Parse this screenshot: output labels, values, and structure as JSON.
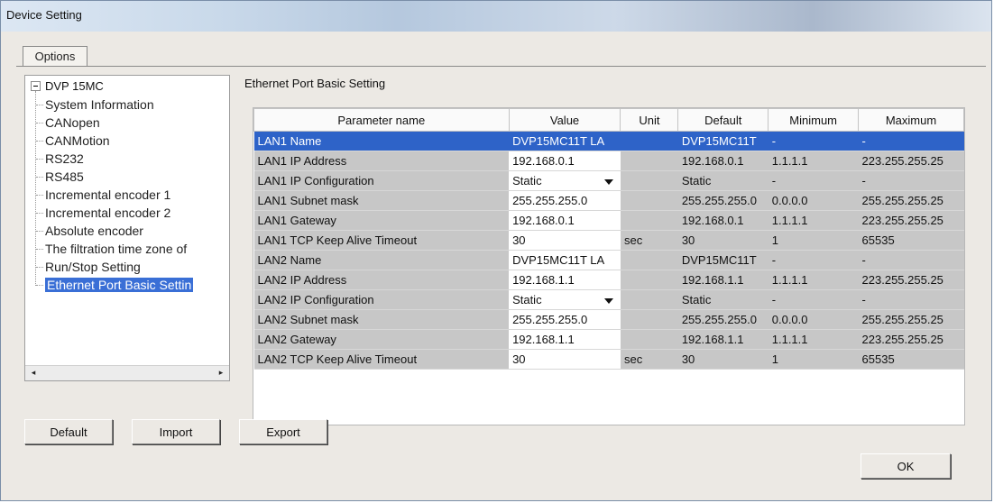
{
  "window": {
    "title": "Device Setting"
  },
  "tab": {
    "label": "Options"
  },
  "tree": {
    "root": "DVP 15MC",
    "items": [
      {
        "label": "System Information",
        "selected": false
      },
      {
        "label": "CANopen",
        "selected": false
      },
      {
        "label": "CANMotion",
        "selected": false
      },
      {
        "label": "RS232",
        "selected": false
      },
      {
        "label": "RS485",
        "selected": false
      },
      {
        "label": "Incremental encoder 1",
        "selected": false
      },
      {
        "label": "Incremental encoder 2",
        "selected": false
      },
      {
        "label": "Absolute encoder",
        "selected": false
      },
      {
        "label": "The filtration time zone of",
        "selected": false
      },
      {
        "label": "Run/Stop Setting",
        "selected": false
      },
      {
        "label": "Ethernet Port Basic Settin",
        "selected": true
      }
    ],
    "scroll_left_icon": "◂",
    "scroll_right_icon": "▸"
  },
  "section_title": "Ethernet Port Basic Setting",
  "table": {
    "columns": [
      "Parameter name",
      "Value",
      "Unit",
      "Default",
      "Minimum",
      "Maximum"
    ],
    "rows": [
      {
        "name": "LAN1 Name",
        "value": "DVP15MC11T LA",
        "unit": "",
        "default": "DVP15MC11T",
        "min": "-",
        "max": "-",
        "dropdown": false,
        "selected": true
      },
      {
        "name": "LAN1 IP Address",
        "value": "192.168.0.1",
        "unit": "",
        "default": "192.168.0.1",
        "min": "1.1.1.1",
        "max": "223.255.255.25",
        "dropdown": false,
        "selected": false
      },
      {
        "name": "LAN1 IP Configuration",
        "value": "Static",
        "unit": "",
        "default": "Static",
        "min": "-",
        "max": "-",
        "dropdown": true,
        "selected": false
      },
      {
        "name": "LAN1 Subnet mask",
        "value": "255.255.255.0",
        "unit": "",
        "default": "255.255.255.0",
        "min": "0.0.0.0",
        "max": "255.255.255.25",
        "dropdown": false,
        "selected": false
      },
      {
        "name": "LAN1 Gateway",
        "value": "192.168.0.1",
        "unit": "",
        "default": "192.168.0.1",
        "min": "1.1.1.1",
        "max": "223.255.255.25",
        "dropdown": false,
        "selected": false
      },
      {
        "name": "LAN1 TCP Keep Alive Timeout",
        "value": "30",
        "unit": "sec",
        "default": "30",
        "min": "1",
        "max": "65535",
        "dropdown": false,
        "selected": false
      },
      {
        "name": "LAN2 Name",
        "value": "DVP15MC11T LA",
        "unit": "",
        "default": "DVP15MC11T",
        "min": "-",
        "max": "-",
        "dropdown": false,
        "selected": false
      },
      {
        "name": "LAN2 IP Address",
        "value": "192.168.1.1",
        "unit": "",
        "default": "192.168.1.1",
        "min": "1.1.1.1",
        "max": "223.255.255.25",
        "dropdown": false,
        "selected": false
      },
      {
        "name": "LAN2 IP Configuration",
        "value": "Static",
        "unit": "",
        "default": "Static",
        "min": "-",
        "max": "-",
        "dropdown": true,
        "selected": false
      },
      {
        "name": "LAN2 Subnet mask",
        "value": "255.255.255.0",
        "unit": "",
        "default": "255.255.255.0",
        "min": "0.0.0.0",
        "max": "255.255.255.25",
        "dropdown": false,
        "selected": false
      },
      {
        "name": "LAN2 Gateway",
        "value": "192.168.1.1",
        "unit": "",
        "default": "192.168.1.1",
        "min": "1.1.1.1",
        "max": "223.255.255.25",
        "dropdown": false,
        "selected": false
      },
      {
        "name": "LAN2 TCP Keep Alive Timeout",
        "value": "30",
        "unit": "sec",
        "default": "30",
        "min": "1",
        "max": "65535",
        "dropdown": false,
        "selected": false
      }
    ]
  },
  "buttons": {
    "default": "Default",
    "import": "Import",
    "export": "Export",
    "ok": "OK"
  },
  "colors": {
    "selection": "#2e63c8",
    "readonly_cell": "#c7c7c7",
    "editable_cell": "#ffffff"
  }
}
